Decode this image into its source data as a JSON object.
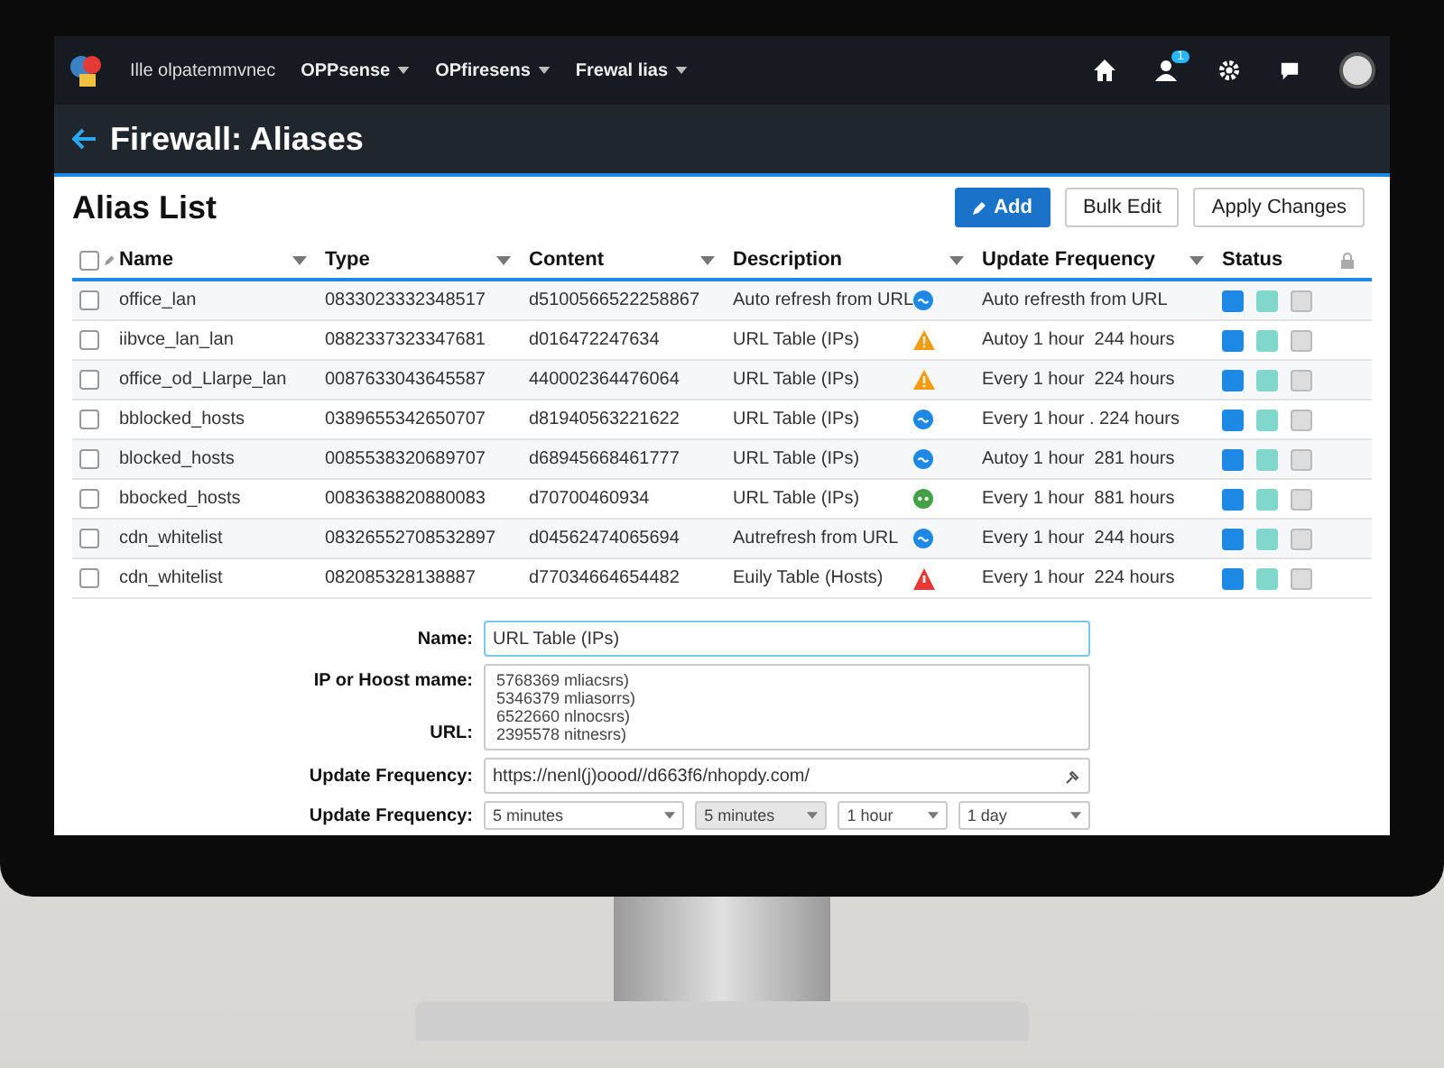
{
  "top_bar": {
    "site_text": "Ille olpatemmvnec",
    "menus": [
      {
        "label": "OPPsense"
      },
      {
        "label": "OPfiresens"
      },
      {
        "label": "Frewal lias"
      }
    ],
    "notification_badge": "1"
  },
  "page_title": "Firewall: Aliases",
  "alias_list": {
    "title": "Alias List",
    "buttons": [
      {
        "label": "Add",
        "kind": "primary"
      },
      {
        "label": "Bulk Edit",
        "kind": "default"
      },
      {
        "label": "Apply Changes",
        "kind": "default"
      }
    ],
    "select_all_checked": false,
    "columns": [
      "Name",
      "Type",
      "Content",
      "Description",
      "Update Frequency",
      "Status"
    ],
    "rows": [
      {
        "checked": false,
        "name": "office_lan",
        "type": "0833023332348517",
        "content": "d5100566522258867",
        "description": "Auto refresh from URL",
        "kind": "info",
        "frequency": "Auto refresth from URL"
      },
      {
        "checked": false,
        "name": "iibvce_lan_lan",
        "type": "0882337323347681",
        "content": "d016472247634",
        "description": "URL Table (IPs)",
        "kind": "warning",
        "frequency": "Autoy 1 hour  244 hours"
      },
      {
        "checked": false,
        "name": "office_od_Llarpe_lan",
        "type": "0087633043645587",
        "content": "440002364476064",
        "description": "URL Table (IPs)",
        "kind": "warning",
        "frequency": "Every 1 hour  224 hours"
      },
      {
        "checked": false,
        "name": "bblocked_hosts",
        "type": "0389655342650707",
        "content": "d81940563221622",
        "description": "URL Table (IPs)",
        "kind": "info",
        "frequency": "Every 1 hour . 224 hours"
      },
      {
        "checked": false,
        "name": "blocked_hosts",
        "type": "0085538320689707",
        "content": "d68945668461777",
        "description": "URL Table (IPs)",
        "kind": "info",
        "frequency": "Autoy 1 hour  281 hours"
      },
      {
        "checked": false,
        "name": "bbocked_hosts",
        "type": "0083638820880083",
        "content": "d70700460934",
        "description": "URL Table (IPs)",
        "kind": "ok",
        "frequency": "Every 1 hour  881 hours"
      },
      {
        "checked": false,
        "name": "cdn_whitelist",
        "type": "08326552708532897",
        "content": "d04562474065694",
        "description": "Autrefresh from URL",
        "kind": "info",
        "frequency": "Every 1 hour  244 hours"
      },
      {
        "checked": false,
        "name": "cdn_whitelist",
        "type": "082085328138887",
        "content": "d77034664654482",
        "description": "Euily Table (Hosts)",
        "kind": "error",
        "frequency": "Every 1 hour  224 hours"
      }
    ]
  },
  "form": {
    "name_label": "Name:",
    "name_value": "URL Table (IPs)",
    "host_label": "IP or Hoost mame:",
    "url_label": "URL:",
    "host_lines": [
      "5768369 mliacsrs)",
      "5346379 mliasorrs)",
      "6522660 nlnocsrs)",
      "2395578 nitnesrs)"
    ],
    "freq_label": "Update Frequency:",
    "freq_value": "https://nenl(j)oood//d663f6/nhopdy.com/",
    "freq2_label": "Update Frequency:",
    "selects": [
      {
        "label": "5 minutes",
        "selected": false
      },
      {
        "label": "5 minutes",
        "selected": true
      },
      {
        "label": "1 hour",
        "selected": false
      },
      {
        "label": "1 day",
        "selected": false
      }
    ]
  }
}
